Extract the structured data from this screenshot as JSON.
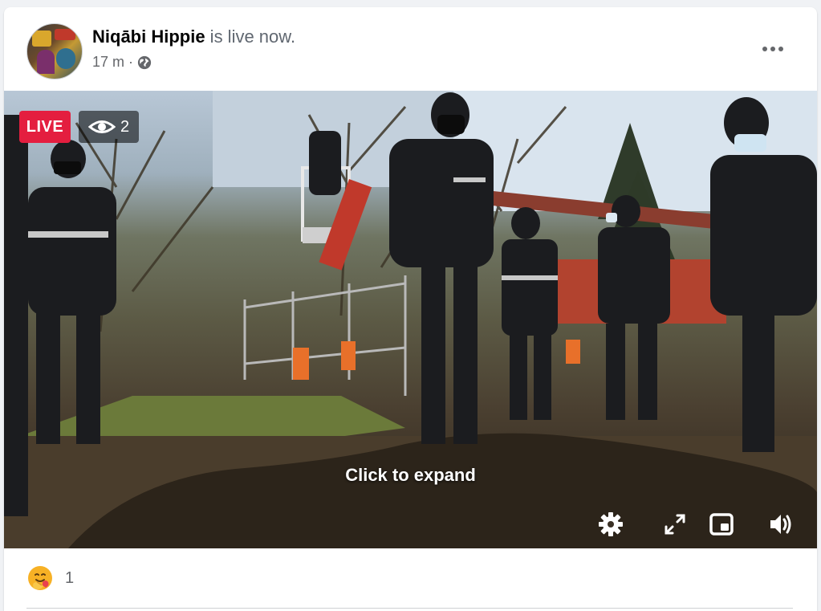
{
  "post": {
    "author": "Niqābi Hippie",
    "status_text": " is live now.",
    "time_ago": "17 m",
    "separator": "·",
    "privacy_icon": "globe-icon",
    "more_icon": "more-horizontal-icon"
  },
  "video": {
    "live_label": "LIVE",
    "viewer_count": "2",
    "viewer_icon": "eye-icon",
    "overlay_text": "Click to expand",
    "controls": [
      "gear-icon",
      "fullscreen-icon",
      "picture-in-picture-icon",
      "volume-icon"
    ]
  },
  "reactions": {
    "icon": "care-reaction-icon",
    "count": "1"
  },
  "colors": {
    "live_badge": "#e41e3f",
    "text_secondary": "#65676b",
    "text_primary": "#050505",
    "care_reaction": "#f7b125"
  }
}
